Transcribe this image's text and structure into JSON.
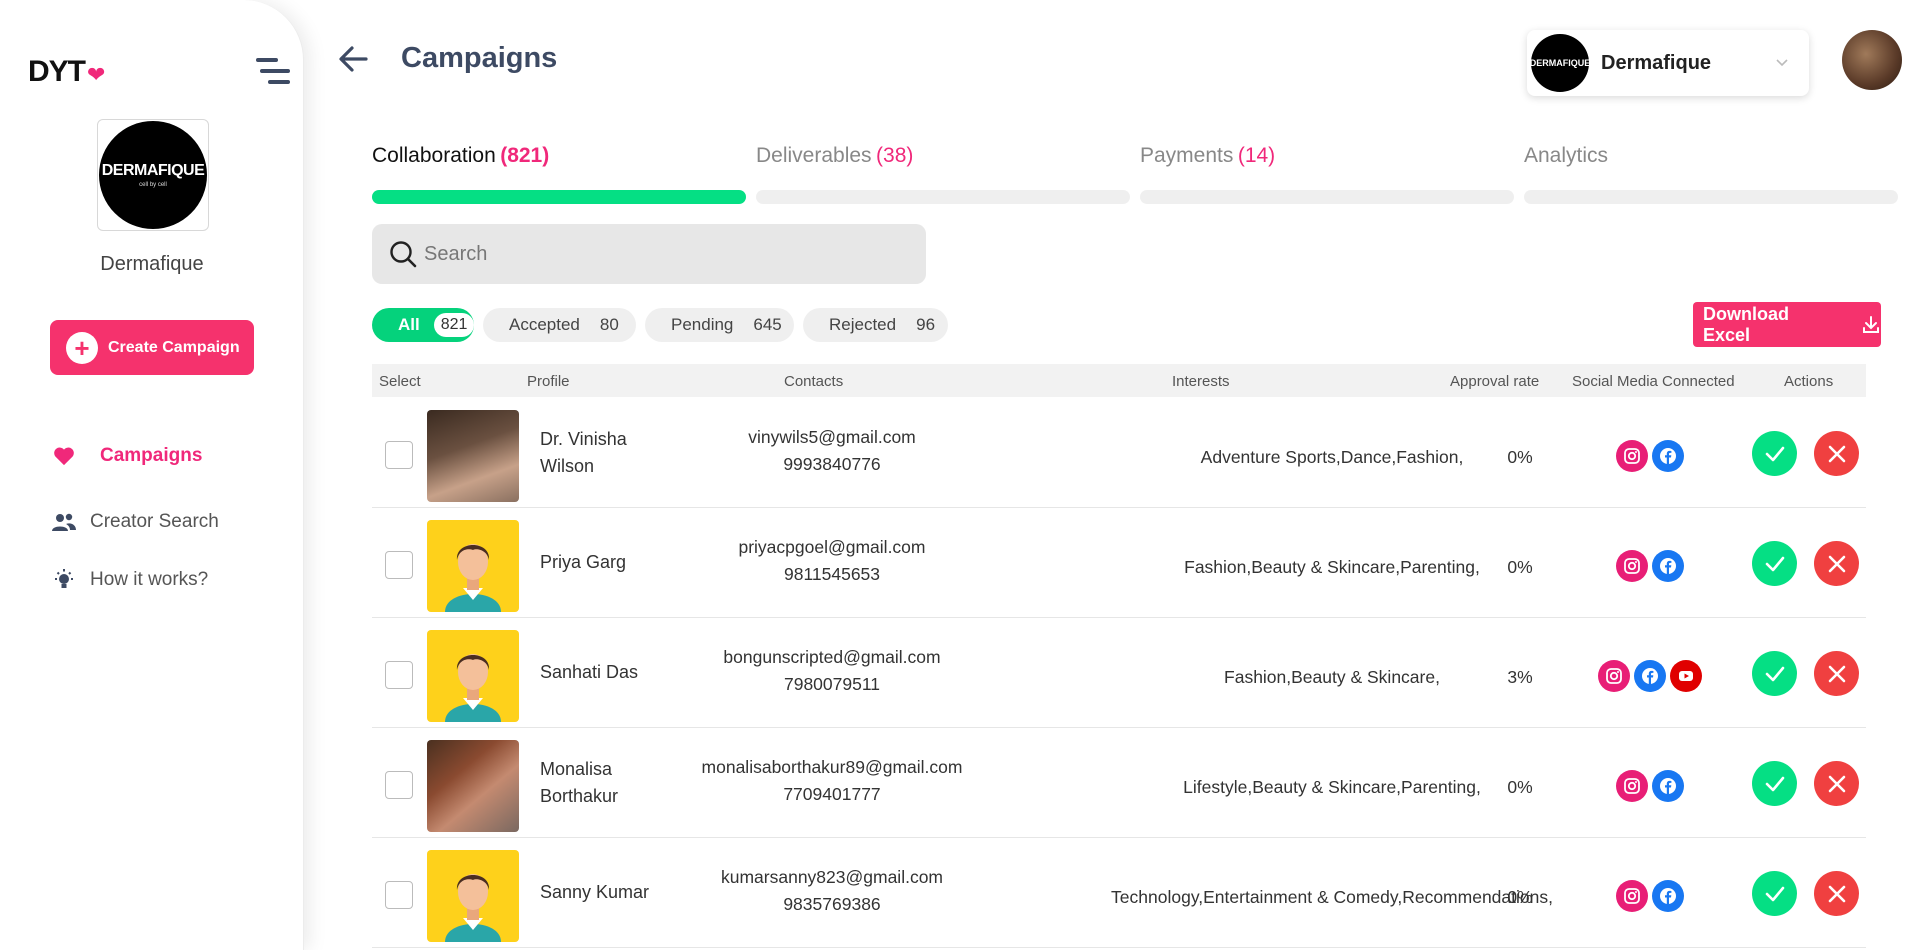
{
  "app": {
    "logo_text": "DYT"
  },
  "sidebar": {
    "brand_logo_text": "DERMAFIQUE",
    "brand_logo_sub": "cell by cell",
    "brand_name": "Dermafique",
    "create_label": "Create Campaign",
    "nav": [
      {
        "label": "Campaigns",
        "icon": "heart-icon",
        "active": true
      },
      {
        "label": "Creator Search",
        "icon": "users-icon"
      },
      {
        "label": "How it works?",
        "icon": "lightbulb-icon"
      }
    ]
  },
  "header": {
    "title": "Campaigns",
    "brand_selector": {
      "logo_text": "DERMAFIQUE",
      "selected": "Dermafique"
    }
  },
  "tabs": [
    {
      "label": "Collaboration",
      "count": "(821)",
      "active": true
    },
    {
      "label": "Deliverables",
      "count": "(38)"
    },
    {
      "label": "Payments",
      "count": "(14)"
    },
    {
      "label": "Analytics",
      "count": ""
    }
  ],
  "search": {
    "placeholder": "Search"
  },
  "filters": [
    {
      "label": "All",
      "count": "821",
      "active": true
    },
    {
      "label": "Accepted",
      "count": "80"
    },
    {
      "label": "Pending",
      "count": "645"
    },
    {
      "label": "Rejected",
      "count": "96"
    }
  ],
  "download_label": "Download Excel",
  "colors": {
    "accent_pink": "#f5326d",
    "accent_green": "#05df84",
    "reject_red": "#f04040"
  },
  "table": {
    "headers": [
      "Select",
      "Profile",
      "Contacts",
      "Interests",
      "Approval rate",
      "Social Media Connected",
      "Actions"
    ],
    "rows": [
      {
        "name_line1": "Dr. Vinisha",
        "name_line2": "Wilson",
        "email": "vinywils5@gmail.com",
        "phone": "9993840776",
        "interests": "Adventure Sports,Dance,Fashion,",
        "approval": "0%",
        "social": [
          "instagram",
          "facebook"
        ],
        "avatar": "photo"
      },
      {
        "name_line1": "Priya Garg",
        "name_line2": "",
        "email": "priyacpgoel@gmail.com",
        "phone": "9811545653",
        "interests": "Fashion,Beauty & Skincare,Parenting,",
        "approval": "0%",
        "social": [
          "instagram",
          "facebook"
        ],
        "avatar": "default"
      },
      {
        "name_line1": "Sanhati Das",
        "name_line2": "",
        "email": "bongunscripted@gmail.com",
        "phone": "7980079511",
        "interests": "Fashion,Beauty & Skincare,",
        "approval": "3%",
        "social": [
          "instagram",
          "facebook",
          "youtube"
        ],
        "avatar": "default"
      },
      {
        "name_line1": "Monalisa",
        "name_line2": "Borthakur",
        "email": "monalisaborthakur89@gmail.com",
        "phone": "7709401777",
        "interests": "Lifestyle,Beauty & Skincare,Parenting,",
        "approval": "0%",
        "social": [
          "instagram",
          "facebook"
        ],
        "avatar": "photo"
      },
      {
        "name_line1": "Sanny Kumar",
        "name_line2": "",
        "email": "kumarsanny823@gmail.com",
        "phone": "9835769386",
        "interests": "Technology,Entertainment & Comedy,Recommendations,",
        "approval": "0%",
        "social": [
          "instagram",
          "facebook"
        ],
        "avatar": "default"
      }
    ]
  }
}
